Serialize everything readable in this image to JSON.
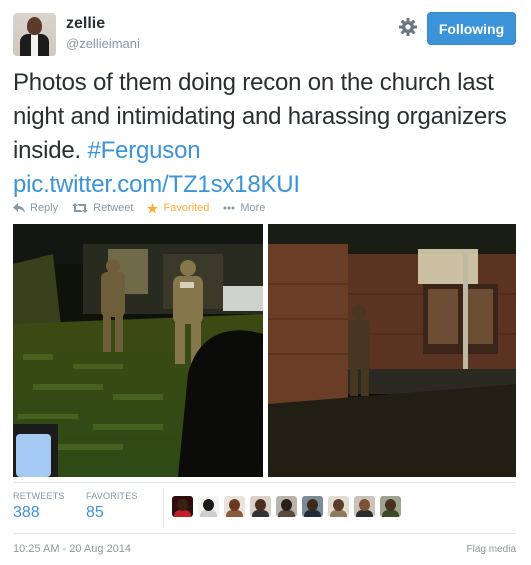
{
  "author": {
    "display_name": "zellie",
    "username": "@zellieimani"
  },
  "follow_button": {
    "label": "Following"
  },
  "tweet": {
    "text_main": "Photos of them doing recon on the church last night and intimidating and harassing organizers inside. ",
    "hashtag": "#Ferguson",
    "link": "pic.twitter.com/TZ1sx18KUI"
  },
  "actions": {
    "reply": "Reply",
    "retweet": "Retweet",
    "favorite": "Favorited",
    "more": "More"
  },
  "stats": {
    "retweets_label": "RETWEETS",
    "retweets_value": "388",
    "favorites_label": "FAVORITES",
    "favorites_value": "85"
  },
  "timestamp": "10:25 AM - 20 Aug 2014",
  "flag_media": "Flag media",
  "colors": {
    "accent": "#3b94d9",
    "favorite": "#ffac33",
    "muted": "#8899a6"
  }
}
